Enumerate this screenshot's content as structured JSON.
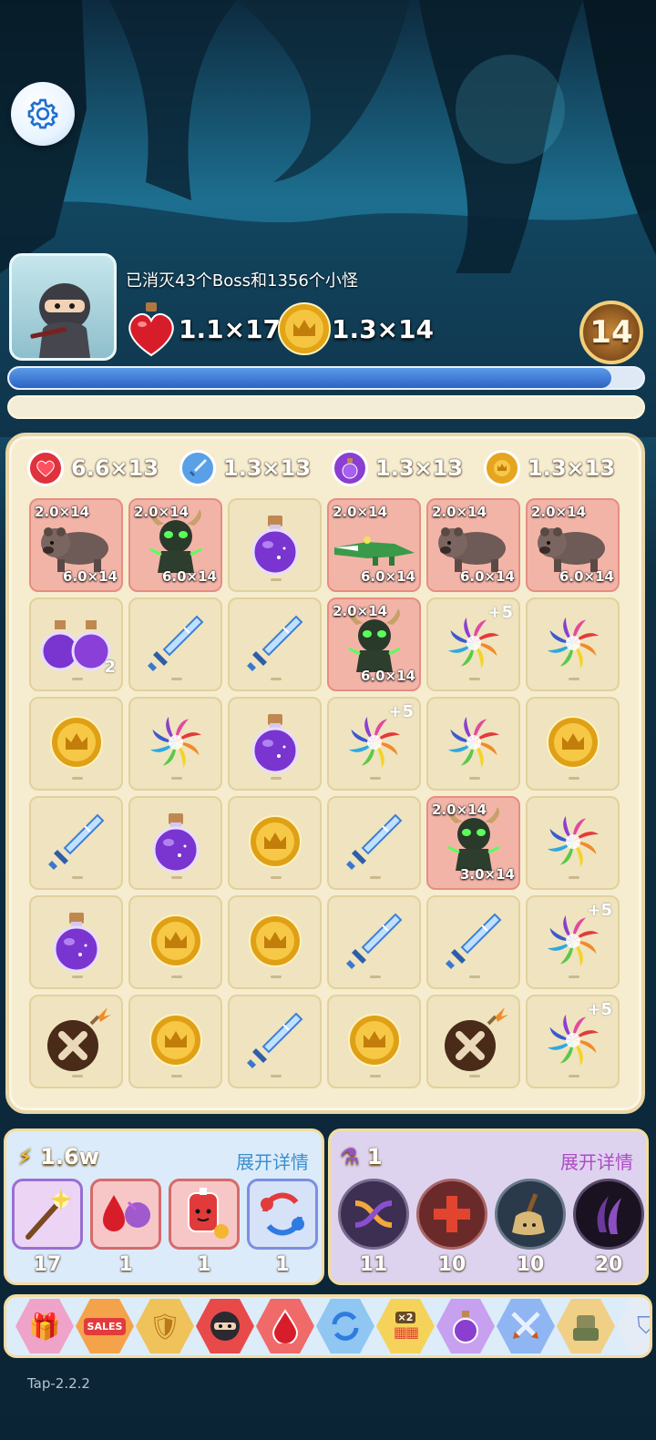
{
  "header": {
    "kill_text": "已消灭43个Boss和1356个小怪",
    "heart_multiplier": "1.1×17",
    "coin_multiplier": "1.3×14",
    "level": "14",
    "hp_progress": 0.95,
    "xp_progress": 0.0
  },
  "board_stats": [
    {
      "icon": "heart-icon",
      "value": "6.6×13"
    },
    {
      "icon": "sword-icon",
      "value": "1.3×13"
    },
    {
      "icon": "potion-icon",
      "value": "1.3×13"
    },
    {
      "icon": "coin-icon",
      "value": "1.3×13"
    }
  ],
  "grid": [
    [
      {
        "type": "hyena",
        "top": "2.0×14",
        "bottom": "6.0×14"
      },
      {
        "type": "demon",
        "top": "2.0×14",
        "bottom": "6.0×14"
      },
      {
        "type": "potion"
      },
      {
        "type": "crocodile",
        "top": "2.0×14",
        "bottom": "6.0×14"
      },
      {
        "type": "hyena",
        "top": "2.0×14",
        "bottom": "6.0×14"
      },
      {
        "type": "hyena",
        "top": "2.0×14",
        "bottom": "6.0×14"
      }
    ],
    [
      {
        "type": "potion-double",
        "count": "2"
      },
      {
        "type": "sword"
      },
      {
        "type": "sword"
      },
      {
        "type": "demon",
        "top": "2.0×14",
        "bottom": "6.0×14"
      },
      {
        "type": "rainbow",
        "plus": "+5"
      },
      {
        "type": "rainbow"
      }
    ],
    [
      {
        "type": "coin"
      },
      {
        "type": "rainbow"
      },
      {
        "type": "potion"
      },
      {
        "type": "rainbow",
        "plus": "+5"
      },
      {
        "type": "rainbow"
      },
      {
        "type": "coin"
      }
    ],
    [
      {
        "type": "sword"
      },
      {
        "type": "potion"
      },
      {
        "type": "coin"
      },
      {
        "type": "sword"
      },
      {
        "type": "demon",
        "top": "2.0×14",
        "bottom": "3.0×14"
      },
      {
        "type": "rainbow"
      }
    ],
    [
      {
        "type": "potion"
      },
      {
        "type": "coin"
      },
      {
        "type": "coin"
      },
      {
        "type": "sword"
      },
      {
        "type": "sword"
      },
      {
        "type": "rainbow",
        "plus": "+5"
      }
    ],
    [
      {
        "type": "bomb"
      },
      {
        "type": "coin"
      },
      {
        "type": "sword"
      },
      {
        "type": "coin"
      },
      {
        "type": "bomb"
      },
      {
        "type": "rainbow",
        "plus": "+5"
      }
    ]
  ],
  "left_panel": {
    "energy": "1.6w",
    "expand_label": "展开详情",
    "tools": [
      {
        "icon": "magic-wand-icon",
        "count": "17"
      },
      {
        "icon": "blood-drop-swap-icon",
        "count": "1"
      },
      {
        "icon": "blood-bag-icon",
        "count": "1"
      },
      {
        "icon": "refresh-icon",
        "count": "1"
      }
    ]
  },
  "right_panel": {
    "potions": "1",
    "expand_label": "展开详情",
    "skills": [
      {
        "icon": "shuffle-icon",
        "count": "11"
      },
      {
        "icon": "cross-heal-icon",
        "count": "10"
      },
      {
        "icon": "broom-icon",
        "count": "10"
      },
      {
        "icon": "dark-slash-icon",
        "count": "20"
      }
    ]
  },
  "bottom_bar": {
    "items": [
      "gift-icon",
      "sales-icon",
      "shield-icon",
      "ninja-icon",
      "blood-drop-icon",
      "refresh-hex-icon",
      "x2-blocks-icon",
      "potion-hex-icon",
      "crossed-swords-icon",
      "golem-icon",
      "shield-partial-icon"
    ],
    "sales_label": "SALES",
    "x2_label": "×2"
  },
  "version": "Tap-2.2.2",
  "colors": {
    "monster_cell": "#f3b4a8",
    "cell": "#efe4bf",
    "accent_blue": "#3a8fd0",
    "accent_purple": "#9a4fc8"
  }
}
